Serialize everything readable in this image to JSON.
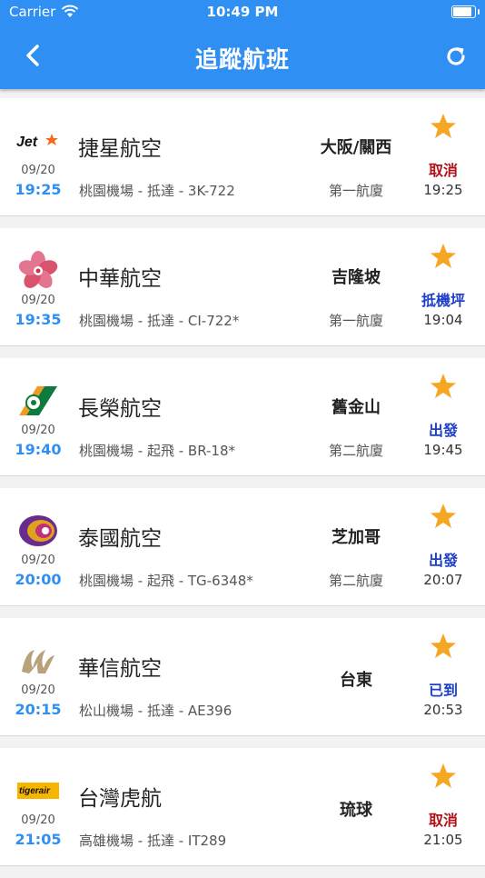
{
  "status_bar": {
    "carrier": "Carrier",
    "time": "10:49 PM"
  },
  "header": {
    "title": "追蹤航班"
  },
  "colors": {
    "header": "#2f8ff2",
    "time_blue": "#2f8ff2",
    "cancel": "#b0121b",
    "status_blue": "#1e40c8",
    "star": "#f5a623"
  },
  "flights": [
    {
      "logo": "jetstar-logo",
      "logo_text": "Jet",
      "airline": "捷星航空",
      "date": "09/20",
      "time": "19:25",
      "info": "桃園機場 - 抵達 - 3K-722",
      "destination": "大阪/關西",
      "terminal": "第一航廈",
      "status": "取消",
      "status_color": "#b0121b",
      "status_time": "19:25"
    },
    {
      "logo": "china-airlines-logo",
      "airline": "中華航空",
      "date": "09/20",
      "time": "19:35",
      "info": "桃園機場 - 抵達 - CI-722*",
      "destination": "吉隆坡",
      "terminal": "第一航廈",
      "status": "抵機坪",
      "status_color": "#1e40c8",
      "status_time": "19:04"
    },
    {
      "logo": "eva-air-logo",
      "airline": "長榮航空",
      "date": "09/20",
      "time": "19:40",
      "info": "桃園機場 - 起飛 - BR-18*",
      "destination": "舊金山",
      "terminal": "第二航廈",
      "status": "出發",
      "status_color": "#1e40c8",
      "status_time": "19:45"
    },
    {
      "logo": "thai-airways-logo",
      "airline": "泰國航空",
      "date": "09/20",
      "time": "20:00",
      "info": "桃園機場 - 起飛 - TG-6348*",
      "destination": "芝加哥",
      "terminal": "第二航廈",
      "status": "出發",
      "status_color": "#1e40c8",
      "status_time": "20:07"
    },
    {
      "logo": "mandarin-airlines-logo",
      "airline": "華信航空",
      "date": "09/20",
      "time": "20:15",
      "info": "松山機場 - 抵達 - AE396",
      "destination": "台東",
      "terminal": "",
      "status": "已到",
      "status_color": "#1e40c8",
      "status_time": "20:53"
    },
    {
      "logo": "tigerair-logo",
      "logo_text": "tigerair",
      "airline": "台灣虎航",
      "date": "09/20",
      "time": "21:05",
      "info": "高雄機場 - 抵達 - IT289",
      "destination": "琉球",
      "terminal": "",
      "status": "取消",
      "status_color": "#b0121b",
      "status_time": "21:05"
    }
  ]
}
